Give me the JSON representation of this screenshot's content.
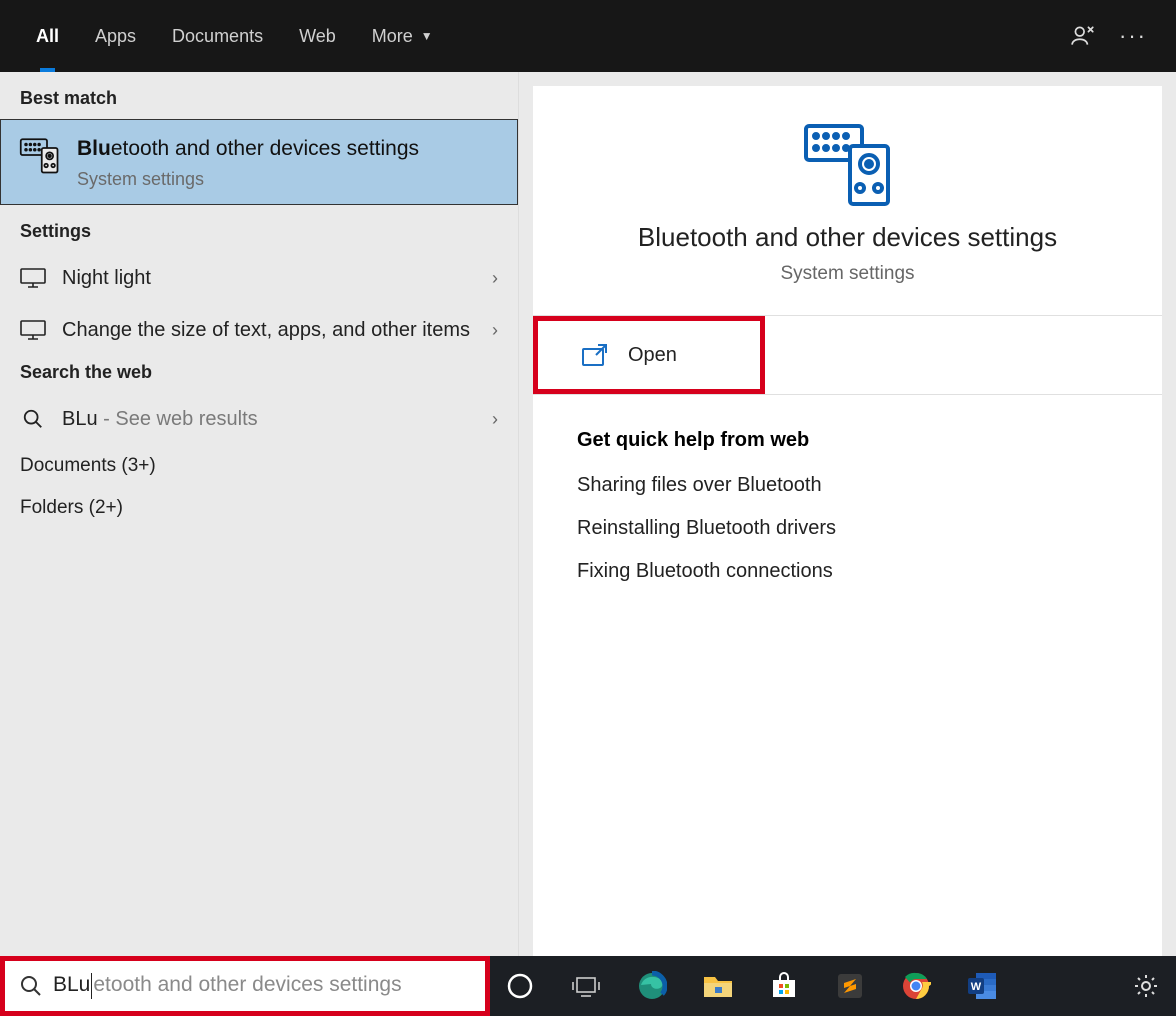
{
  "tabs": {
    "all": "All",
    "apps": "Apps",
    "documents": "Documents",
    "web": "Web",
    "more": "More"
  },
  "left": {
    "best_match_label": "Best match",
    "best_match": {
      "match_prefix": "Blu",
      "match_rest": "etooth and other devices settings",
      "subtitle": "System settings"
    },
    "settings_label": "Settings",
    "settings": [
      {
        "label": "Night light"
      },
      {
        "label": "Change the size of text, apps, and other items"
      }
    ],
    "search_web_label": "Search the web",
    "web_query": "BLu",
    "web_hint": " - See web results",
    "documents_label": "Documents (3+)",
    "folders_label": "Folders (2+)"
  },
  "right": {
    "title": "Bluetooth and other devices settings",
    "subtitle": "System settings",
    "open_label": "Open",
    "help_label": "Get quick help from web",
    "help_links": [
      "Sharing files over Bluetooth",
      "Reinstalling Bluetooth drivers",
      "Fixing Bluetooth connections"
    ]
  },
  "search": {
    "typed": "BLu",
    "ghost": "etooth and other devices settings"
  },
  "taskbar": {
    "items": [
      "cortana",
      "task-view",
      "edge",
      "explorer",
      "store",
      "sublime",
      "chrome",
      "word"
    ]
  }
}
